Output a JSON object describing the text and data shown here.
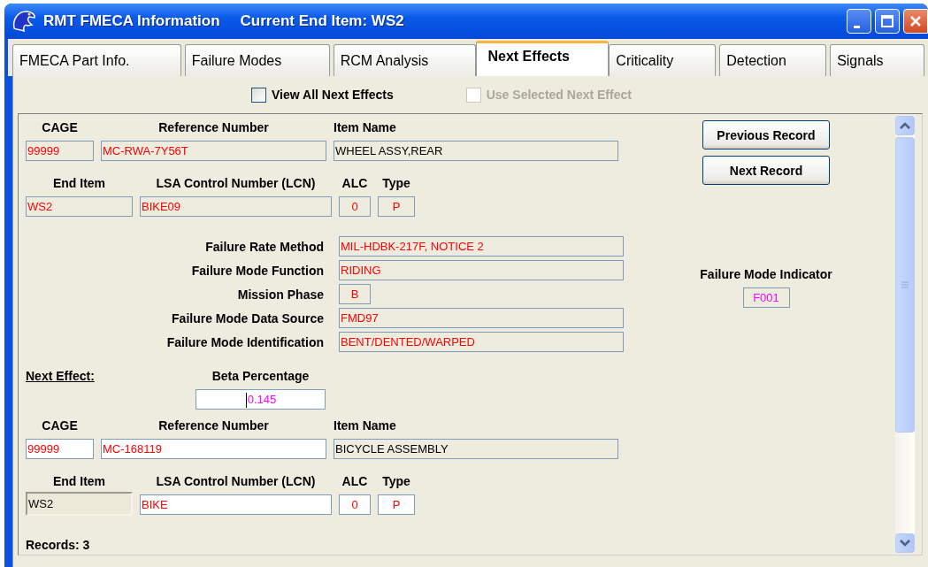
{
  "window": {
    "title": "RMT FMECA Information",
    "subtitle": "Current End Item: WS2"
  },
  "tabs": [
    {
      "label": "FMECA Part Info.",
      "selected": false
    },
    {
      "label": "Failure Modes",
      "selected": false
    },
    {
      "label": "RCM Analysis",
      "selected": false
    },
    {
      "label": "Next Effects",
      "selected": true
    },
    {
      "label": "Criticality",
      "selected": false
    },
    {
      "label": "Detection",
      "selected": false
    },
    {
      "label": "Signals",
      "selected": false
    }
  ],
  "options": [
    {
      "label": "View All Next Effects",
      "checked": false,
      "disabled": false
    },
    {
      "label": "Use Selected Next Effect",
      "checked": false,
      "disabled": true
    }
  ],
  "item": {
    "id_row": [
      {
        "label": "CAGE",
        "value": "99999",
        "color": "#ff0000",
        "editable": false
      },
      {
        "label": "Reference Number",
        "value": "MC-RWA-7Y56T",
        "color": "#ff0000",
        "editable": false
      },
      {
        "label": "Item Name",
        "value": "WHEEL ASSY,REAR",
        "color": "#000000",
        "editable": false
      }
    ],
    "end_row": [
      {
        "label": "End Item",
        "value": "WS2",
        "color": "#ff0000",
        "editable": false,
        "disabled": false
      },
      {
        "label": "LSA Control Number (LCN)",
        "value": "BIKE09",
        "color": "#ff0000",
        "editable": false,
        "disabled": false
      },
      {
        "label": "ALC",
        "value": "0",
        "color": "#ff0000",
        "editable": false,
        "disabled": false
      },
      {
        "label": "Type",
        "value": "P",
        "color": "#ff0000",
        "editable": false,
        "disabled": false
      }
    ],
    "failure_fields": [
      {
        "label": "Failure Rate Method",
        "value": "MIL-HDBK-217F, NOTICE 2",
        "kind": "wide"
      },
      {
        "label": "Failure Mode Function",
        "value": "RIDING",
        "kind": "wide"
      },
      {
        "label": "Mission Phase",
        "value": "B",
        "kind": "short"
      },
      {
        "label": "Failure Mode Data Source",
        "value": "FMD97",
        "kind": "wide"
      },
      {
        "label": "Failure Mode Identification",
        "value": "BENT/DENTED/WARPED",
        "kind": "wide"
      }
    ],
    "indicator": {
      "label": "Failure Mode Indicator",
      "value": "F001",
      "color": "#ff00ff"
    }
  },
  "buttons": [
    "Previous Record",
    "Next Record"
  ],
  "next_effect": {
    "heading": "Next Effect:",
    "beta": {
      "label": "Beta Percentage",
      "value": "0.145",
      "color": "#ff00ff",
      "focused": true
    },
    "id_row": [
      {
        "label": "CAGE",
        "value": "99999",
        "color": "#ff0000",
        "editable": true
      },
      {
        "label": "Reference Number",
        "value": "MC-168119",
        "color": "#ff0000",
        "editable": true
      },
      {
        "label": "Item Name",
        "value": "BICYCLE ASSEMBLY",
        "color": "#000000",
        "editable": false
      }
    ],
    "end_row": [
      {
        "label": "End Item",
        "value": "WS2",
        "color": "#000000",
        "editable": false,
        "disabled": true
      },
      {
        "label": "LSA Control Number (LCN)",
        "value": "BIKE",
        "color": "#ff0000",
        "editable": true,
        "disabled": false
      },
      {
        "label": "ALC",
        "value": "0",
        "color": "#ff0000",
        "editable": true,
        "disabled": false
      },
      {
        "label": "Type",
        "value": "P",
        "color": "#ff0000",
        "editable": true,
        "disabled": false
      }
    ]
  },
  "records": "Records: 3"
}
